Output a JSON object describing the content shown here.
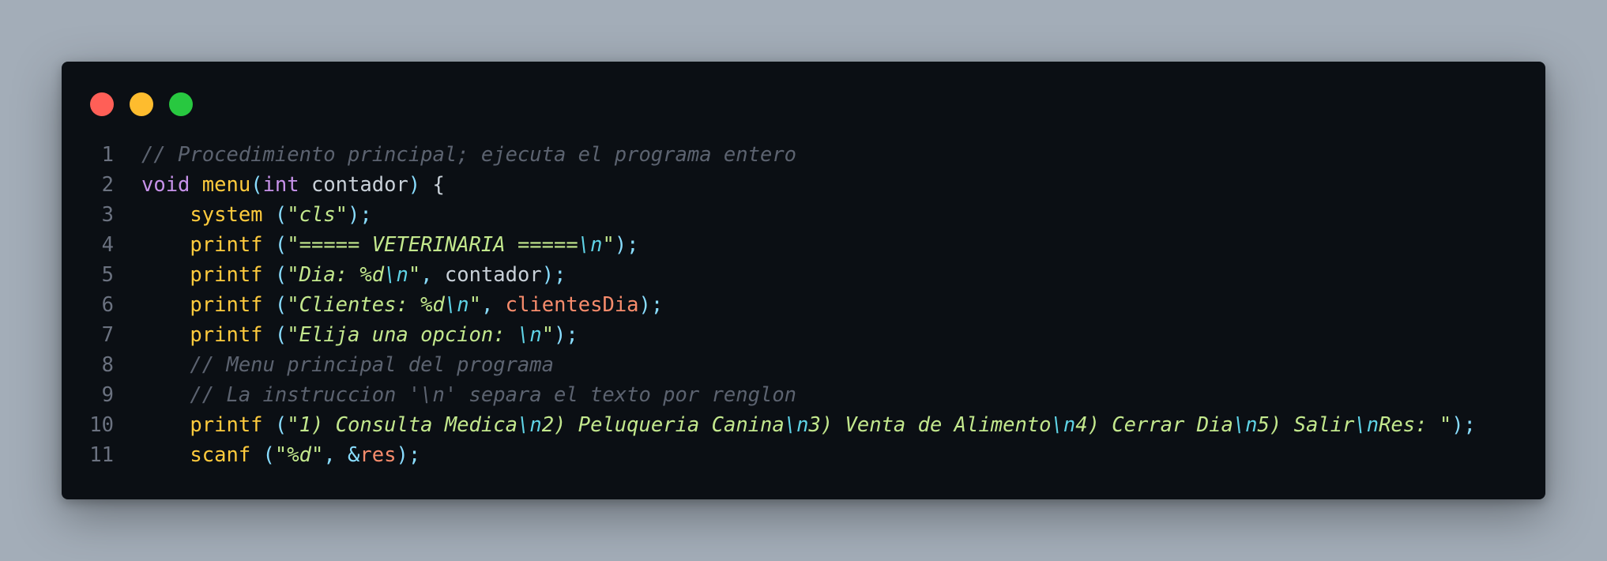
{
  "window": {
    "buttons": [
      "close",
      "minimize",
      "maximize"
    ],
    "colors": {
      "close": "#ff5f57",
      "minimize": "#febc2e",
      "maximize": "#28c840",
      "background": "#0b0f14",
      "page": "#a3adb8"
    }
  },
  "lines": [
    {
      "num": "1",
      "tokens": [
        {
          "t": "// Procedimiento principal; ejecuta el programa entero",
          "c": "cm"
        }
      ]
    },
    {
      "num": "2",
      "tokens": [
        {
          "t": "void",
          "c": "kw"
        },
        {
          "t": " ",
          "c": "va"
        },
        {
          "t": "menu",
          "c": "fn"
        },
        {
          "t": "(",
          "c": "pn"
        },
        {
          "t": "int",
          "c": "kw"
        },
        {
          "t": " contador",
          "c": "va"
        },
        {
          "t": ")",
          "c": "pn"
        },
        {
          "t": " {",
          "c": "va"
        }
      ]
    },
    {
      "num": "3",
      "tokens": [
        {
          "t": "    ",
          "c": "va"
        },
        {
          "t": "system",
          "c": "fn"
        },
        {
          "t": " (",
          "c": "pn"
        },
        {
          "t": "\"cls\"",
          "c": "st"
        },
        {
          "t": ");",
          "c": "pn"
        }
      ]
    },
    {
      "num": "4",
      "tokens": [
        {
          "t": "    ",
          "c": "va"
        },
        {
          "t": "printf",
          "c": "fn"
        },
        {
          "t": " (",
          "c": "pn"
        },
        {
          "t": "\"===== VETERINARIA =====",
          "c": "st"
        },
        {
          "t": "\\n",
          "c": "es"
        },
        {
          "t": "\"",
          "c": "st"
        },
        {
          "t": ");",
          "c": "pn"
        }
      ]
    },
    {
      "num": "5",
      "tokens": [
        {
          "t": "    ",
          "c": "va"
        },
        {
          "t": "printf",
          "c": "fn"
        },
        {
          "t": " (",
          "c": "pn"
        },
        {
          "t": "\"Dia: %d",
          "c": "st"
        },
        {
          "t": "\\n",
          "c": "es"
        },
        {
          "t": "\"",
          "c": "st"
        },
        {
          "t": ", ",
          "c": "pn"
        },
        {
          "t": "contador",
          "c": "va"
        },
        {
          "t": ");",
          "c": "pn"
        }
      ]
    },
    {
      "num": "6",
      "tokens": [
        {
          "t": "    ",
          "c": "va"
        },
        {
          "t": "printf",
          "c": "fn"
        },
        {
          "t": " (",
          "c": "pn"
        },
        {
          "t": "\"Clientes: %d",
          "c": "st"
        },
        {
          "t": "\\n",
          "c": "es"
        },
        {
          "t": "\"",
          "c": "st"
        },
        {
          "t": ", ",
          "c": "pn"
        },
        {
          "t": "clientesDia",
          "c": "gv"
        },
        {
          "t": ");",
          "c": "pn"
        }
      ]
    },
    {
      "num": "7",
      "tokens": [
        {
          "t": "    ",
          "c": "va"
        },
        {
          "t": "printf",
          "c": "fn"
        },
        {
          "t": " (",
          "c": "pn"
        },
        {
          "t": "\"Elija una opcion: ",
          "c": "st"
        },
        {
          "t": "\\n",
          "c": "es"
        },
        {
          "t": "\"",
          "c": "st"
        },
        {
          "t": ");",
          "c": "pn"
        }
      ]
    },
    {
      "num": "8",
      "tokens": [
        {
          "t": "    ",
          "c": "va"
        },
        {
          "t": "// Menu principal del programa",
          "c": "cm"
        }
      ]
    },
    {
      "num": "9",
      "tokens": [
        {
          "t": "    ",
          "c": "va"
        },
        {
          "t": "// La instruccion '\\n' separa el texto por renglon",
          "c": "cm"
        }
      ]
    },
    {
      "num": "10",
      "tokens": [
        {
          "t": "    ",
          "c": "va"
        },
        {
          "t": "printf",
          "c": "fn"
        },
        {
          "t": " (",
          "c": "pn"
        },
        {
          "t": "\"1) Consulta Medica",
          "c": "st"
        },
        {
          "t": "\\n",
          "c": "es"
        },
        {
          "t": "2) Peluqueria Canina",
          "c": "st"
        },
        {
          "t": "\\n",
          "c": "es"
        },
        {
          "t": "3) Venta de Alimento",
          "c": "st"
        },
        {
          "t": "\\n",
          "c": "es"
        },
        {
          "t": "4) Cerrar Dia",
          "c": "st"
        },
        {
          "t": "\\n",
          "c": "es"
        },
        {
          "t": "5) Salir",
          "c": "st"
        },
        {
          "t": "\\n",
          "c": "es"
        },
        {
          "t": "Res: \"",
          "c": "st"
        },
        {
          "t": ");",
          "c": "pn"
        }
      ]
    },
    {
      "num": "11",
      "tokens": [
        {
          "t": "    ",
          "c": "va"
        },
        {
          "t": "scanf",
          "c": "fn"
        },
        {
          "t": " (",
          "c": "pn"
        },
        {
          "t": "\"%d\"",
          "c": "st"
        },
        {
          "t": ", ",
          "c": "pn"
        },
        {
          "t": "&",
          "c": "pn"
        },
        {
          "t": "res",
          "c": "gv"
        },
        {
          "t": ");",
          "c": "pn"
        }
      ]
    }
  ]
}
